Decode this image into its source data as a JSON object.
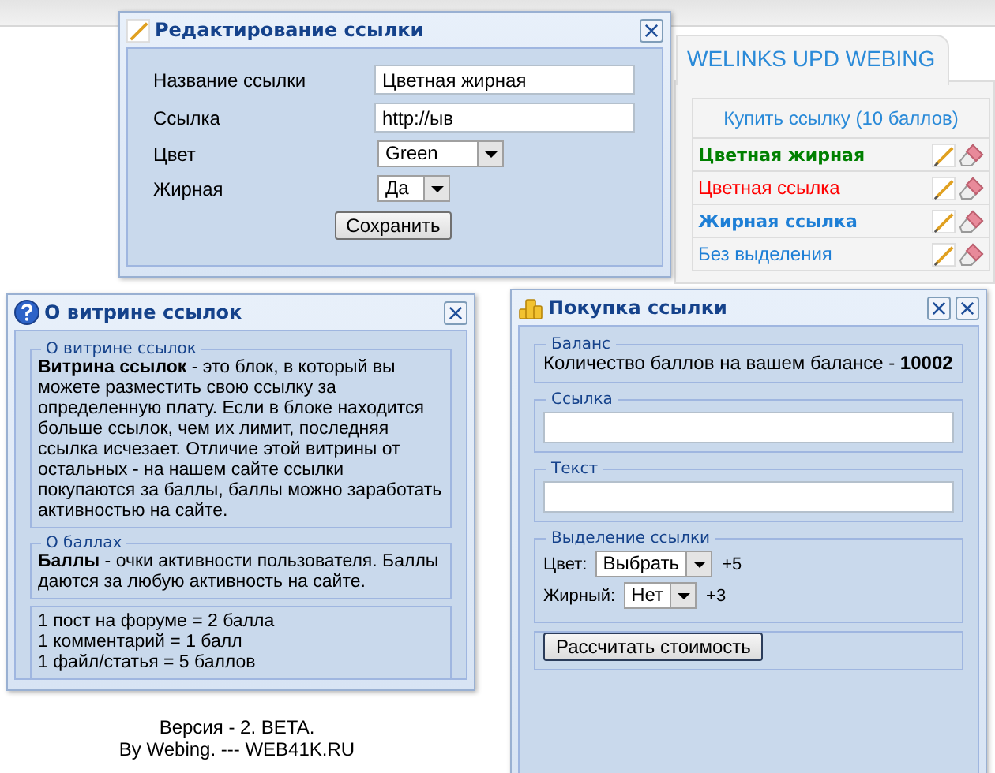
{
  "edit_window": {
    "title": "Редактирование ссылки",
    "fields": [
      {
        "label": "Название ссылки",
        "kind": "text",
        "value": "Цветная жирная"
      },
      {
        "label": "Ссылка",
        "kind": "text",
        "value": "http://ыв"
      },
      {
        "label": "Цвет",
        "kind": "select",
        "value": "Green"
      },
      {
        "label": "Жирная",
        "kind": "select",
        "value": "Да"
      }
    ],
    "save_button": "Сохранить"
  },
  "widget": {
    "tab": "WELINKS UPD WEBING",
    "buy_link": "Купить ссылку (10 баллов)",
    "links": [
      {
        "text": "Цветная жирная",
        "color": "#008000",
        "bold": true
      },
      {
        "text": "Цветная ссылка",
        "color": "#ff0000",
        "bold": false
      },
      {
        "text": "Жирная ссылка",
        "color": "#1e7fd6",
        "bold": true
      },
      {
        "text": "Без выделения",
        "color": "#1e7fd6",
        "bold": false
      }
    ]
  },
  "about_window": {
    "title": "О витрине ссылок",
    "sections": [
      {
        "legend": "О витрине ссылок",
        "text": "**Витрина ссылок** - это блок, в который вы можете разместить свою ссылку за определенную плату. Если в блоке находится больше ссылок, чем их лимит, последняя ссылка исчезает. Отличие этой витрины от остальных - на нашем сайте ссылки покупаются за баллы, баллы можно заработать активностью на сайте."
      },
      {
        "legend": "О баллах",
        "text": "**Баллы** - очки активности пользователя. Баллы даются за любую активность на сайте."
      }
    ],
    "rates": [
      "1 пост на форуме = 2 балла",
      "1 комментарий = 1 балл",
      "1 файл/статья = 5 баллов"
    ]
  },
  "footer": {
    "version": "Версия - 2. BETA.",
    "credit": "By Webing.  ---  WEB41K.RU"
  },
  "purchase_window": {
    "title": "Покупка ссылки",
    "balance": {
      "legend": "Баланс",
      "text": "Количество баллов на вашем балансе - **10002**"
    },
    "link_field": {
      "legend": "Ссылка"
    },
    "text_field": {
      "legend": "Текст"
    },
    "highlight": {
      "legend": "Выделение ссылки",
      "options": [
        {
          "label": "Цвет:",
          "value": "Выбрать",
          "cost": "+5"
        },
        {
          "label": "Жирный:",
          "value": "Нет",
          "cost": "+3"
        }
      ]
    },
    "calculate_button": "Рассчитать стоимость"
  }
}
